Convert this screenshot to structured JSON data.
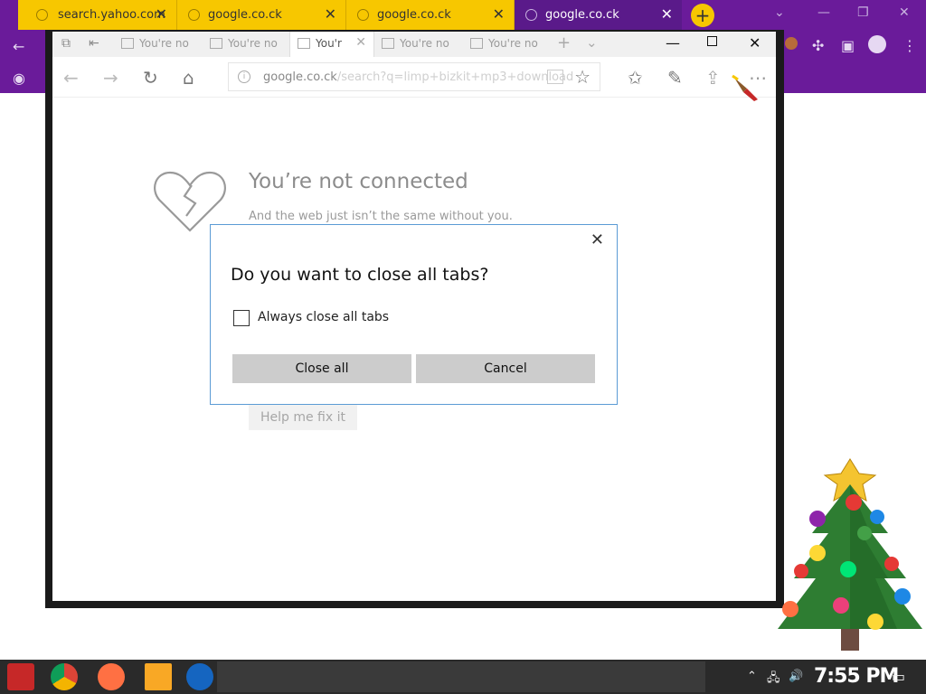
{
  "chrome": {
    "tabs": [
      {
        "title": "search.yahoo.com",
        "active": false
      },
      {
        "title": "google.co.ck",
        "active": false
      },
      {
        "title": "google.co.ck",
        "active": false
      },
      {
        "title": "google.co.ck",
        "active": true
      }
    ],
    "newtab_label": "+"
  },
  "edge": {
    "tabs": [
      {
        "label": "You're no",
        "active": false
      },
      {
        "label": "You're no",
        "active": false
      },
      {
        "label": "You'r",
        "active": true
      },
      {
        "label": "You're no",
        "active": false
      },
      {
        "label": "You're no",
        "active": false
      }
    ],
    "address": {
      "host": "google.co.ck",
      "path": "/search?q=limp+bizkit+mp3+download"
    },
    "error": {
      "title": "You’re not connected",
      "subtitle": "And the web just isn’t the same without you.",
      "fix_button": "Help me fix it"
    }
  },
  "dialog": {
    "title": "Do you want to close all tabs?",
    "checkbox_label": "Always close all tabs",
    "checkbox_checked": false,
    "close_all_label": "Close all",
    "cancel_label": "Cancel"
  },
  "taskbar": {
    "clock": "7:55 PM"
  },
  "colors": {
    "chrome_frame": "#6a1b9a",
    "chrome_tab": "#f7c700",
    "dialog_border": "#5b9bd5"
  }
}
